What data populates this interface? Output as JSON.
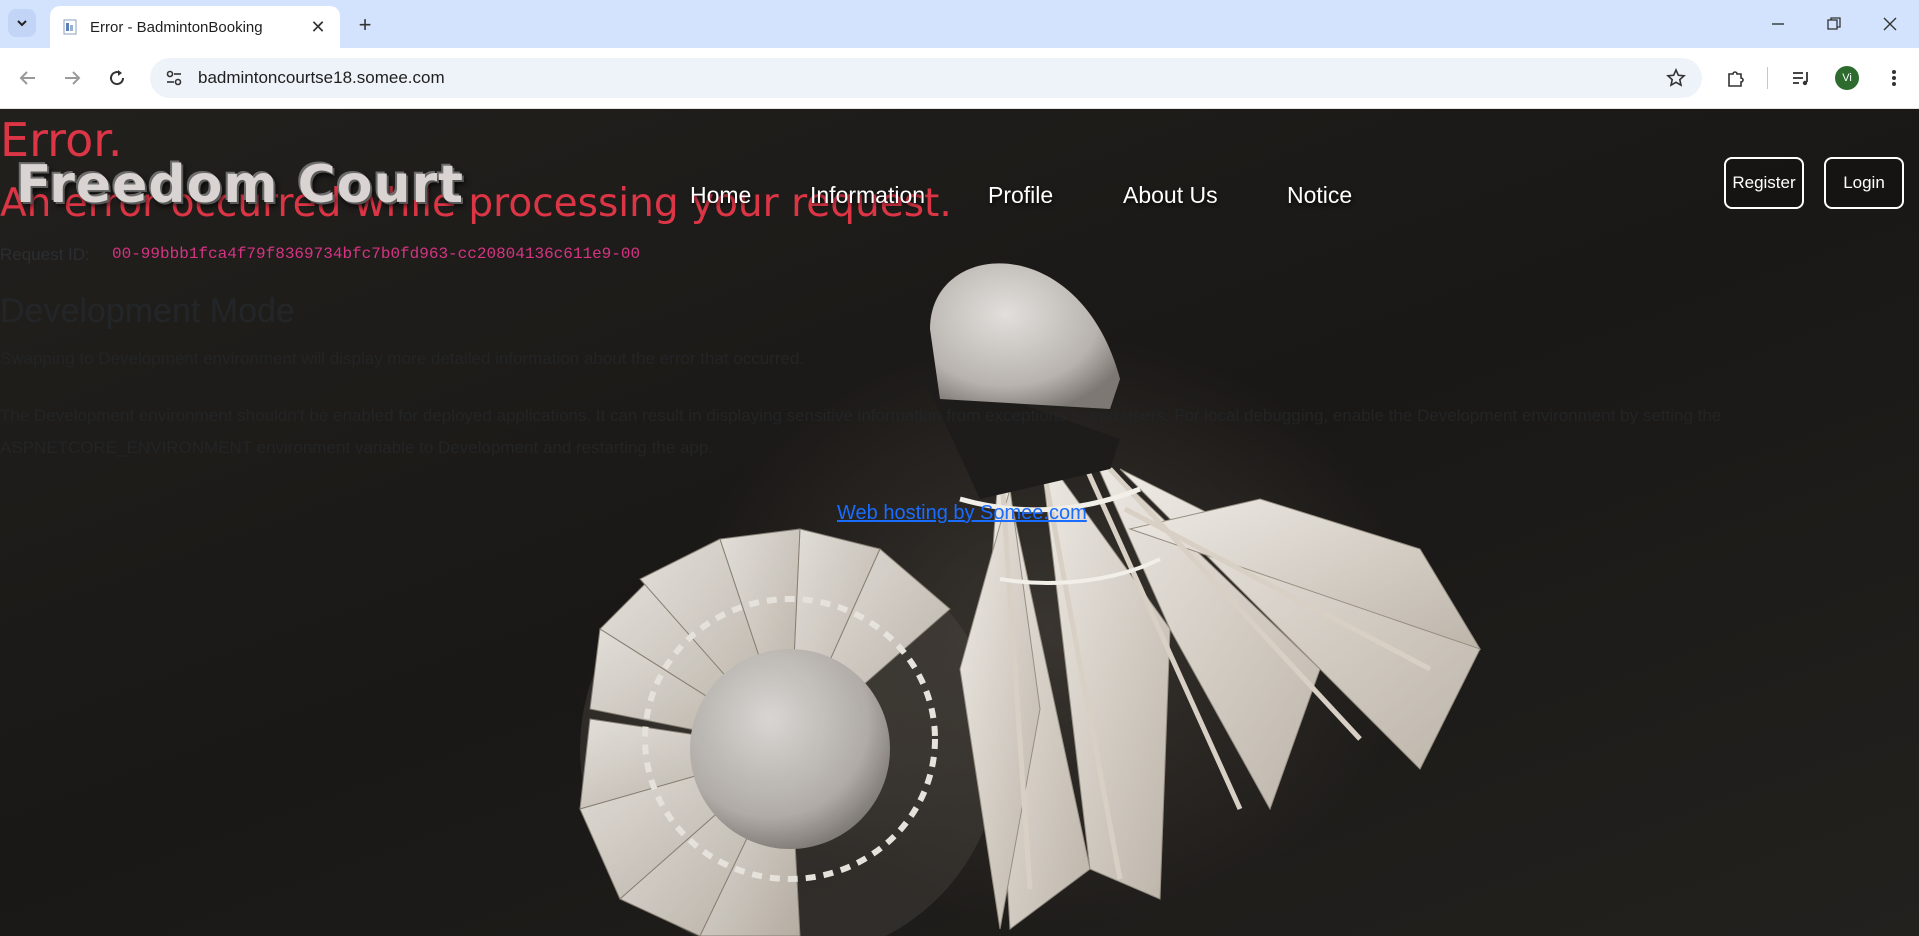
{
  "browser": {
    "tab_title": "Error - BadmintonBooking",
    "url": "badmintoncourtse18.somee.com",
    "profile_initial": "Vi"
  },
  "page": {
    "error_title": "Error.",
    "error_subtitle": "An error occurred while processing your request.",
    "request_id_label": "Request ID:",
    "request_id": "00-99bbb1fca4f79f8369734bfc7b0fd963-cc20804136c611e9-00",
    "dev_heading": "Development Mode",
    "dev_para1": "Swapping to Development environment will display more detailed information about the error that occurred.",
    "dev_para2": "The Development environment shouldn't be enabled for deployed applications. It can result in displaying sensitive information from exceptions to end users. For local debugging, enable the Development environment by setting the ASPNETCORE_ENVIRONMENT environment variable to Development and restarting the app.",
    "hosting_link": "Web hosting by Somee.com"
  },
  "site": {
    "brand": "Freedom Court",
    "nav": [
      "Home",
      "Information",
      "Profile",
      "About Us",
      "Notice"
    ],
    "register": "Register",
    "login": "Login"
  },
  "colors": {
    "error_red": "#dc3545",
    "request_id_pink": "#d63384",
    "link_blue": "#1a6cff",
    "chrome_tabbar": "#d3e3fd"
  }
}
